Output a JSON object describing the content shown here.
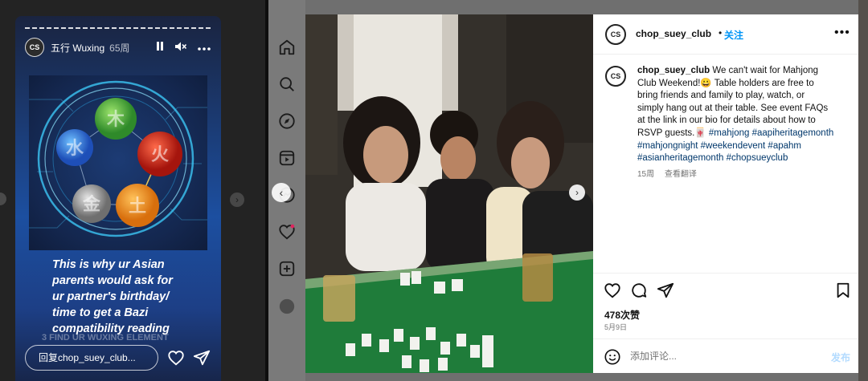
{
  "story": {
    "username": "五行 Wuxing",
    "time": "65周",
    "avatar_text": "CS",
    "text_lines": [
      "This is why ur Asian",
      "parents would ask for",
      "ur partner's birthday/",
      "time to get a Bazi",
      "compatibility reading"
    ],
    "faint_text": "3 FIND UR WUXING ELEMENT",
    "element_glyphs": [
      "木",
      "火",
      "土",
      "金",
      "水"
    ],
    "reply_placeholder": "回复chop_suey_club..."
  },
  "post": {
    "username": "chop_suey_club",
    "dot": "•",
    "follow_label": "关注",
    "more_label": "•••",
    "avatar_text": "CS",
    "caption_lines": [
      [
        {
          "t": "chop_suey_club",
          "c": "u"
        },
        {
          "t": " We can't wait for Mahjong",
          "c": ""
        }
      ],
      [
        {
          "t": "Club Weekend!😀 Table holders are free to",
          "c": ""
        }
      ],
      [
        {
          "t": "bring friends and family to play, watch, or",
          "c": ""
        }
      ],
      [
        {
          "t": "simply hang out at their table. See event FAQs",
          "c": ""
        }
      ],
      [
        {
          "t": "at the link in our bio for details about how to",
          "c": ""
        }
      ],
      [
        {
          "t": "RSVP guests.🀄 ",
          "c": ""
        },
        {
          "t": "#mahjong",
          "c": "h"
        },
        {
          "t": " ",
          "c": ""
        },
        {
          "t": "#aapiheritagemonth",
          "c": "h"
        }
      ],
      [
        {
          "t": "#mahjongnight",
          "c": "h"
        },
        {
          "t": " ",
          "c": ""
        },
        {
          "t": "#weekendevent",
          "c": "h"
        },
        {
          "t": " ",
          "c": ""
        },
        {
          "t": "#apahm",
          "c": "h"
        }
      ],
      [
        {
          "t": "#asianheritagemonth",
          "c": "h"
        },
        {
          "t": " ",
          "c": ""
        },
        {
          "t": "#chopsueyclub",
          "c": "h"
        }
      ]
    ],
    "caption_age": "15周",
    "translate_label": "查看翻译",
    "likes": "478次赞",
    "date": "5月9日",
    "comment_placeholder": "添加评论...",
    "post_label": "发布"
  },
  "nav": {
    "prev": "‹",
    "next": "›"
  },
  "sidebar_icons": [
    "home-icon",
    "search-icon",
    "explore-icon",
    "reels-icon",
    "messages-icon",
    "notifications-icon",
    "create-icon",
    "profile-icon"
  ]
}
